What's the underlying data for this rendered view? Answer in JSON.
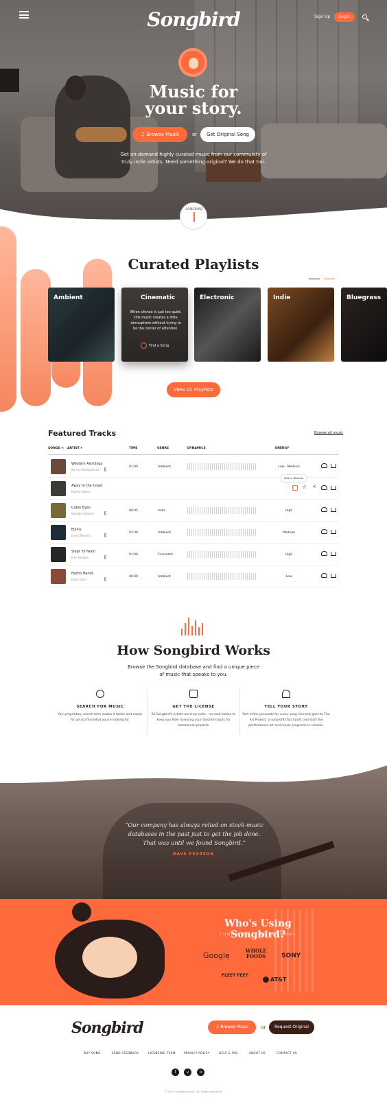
{
  "header": {
    "logo": "Songbird",
    "signup_label": "Sign Up",
    "login_label": "Login"
  },
  "hero": {
    "title_line1": "Music for",
    "title_line2": "your story.",
    "browse_label": "Browse Music",
    "or_label": "or",
    "original_label": "Get Original Song",
    "subtitle": "Get on-demand highly curated music from our community of truly indie artists. Need something original? We do that too.",
    "seal_text": "SONGBIRD"
  },
  "playlists": {
    "title": "Curated Playlists",
    "cards": [
      {
        "label": "Ambient"
      },
      {
        "label": "Cinematic",
        "desc": "When silence is just too quiet, this music creates a little atmosphere without trying to be the center of attention.",
        "action": "Find a Song"
      },
      {
        "label": "Electronic"
      },
      {
        "label": "Indie"
      },
      {
        "label": "Bluegrass"
      }
    ],
    "view_all": "View All Playlists"
  },
  "tracks": {
    "title": "Featured Tracks",
    "browse_all": "Browse all music",
    "headers": {
      "songs": "SONGS",
      "artist": "ARTIST",
      "time": "TIME",
      "genre": "GENRE",
      "dynamics": "DYNAMICS",
      "energy": "ENERGY"
    },
    "tooltip": "Add to Wishlist",
    "rows": [
      {
        "name": "Western Astrology",
        "artist": "Benny Hollingsworth",
        "time": "01:00",
        "genre": "Ambient",
        "energy": "Low - Medium",
        "color": "#6b4a3c"
      },
      {
        "name": "Away to the Coast",
        "artist": "Rachel Wanes",
        "time": "",
        "genre": "",
        "energy": "",
        "color": "#3e3a38"
      },
      {
        "name": "Cabin Eyes",
        "artist": "Georgia Clawson",
        "time": "00:45",
        "genre": "Indie",
        "energy": "High",
        "color": "#7a6a3a"
      },
      {
        "name": "Elkins",
        "artist": "Josiah Benson",
        "time": "02:30",
        "genre": "Ambient",
        "energy": "Medium",
        "color": "#1d2e3a"
      },
      {
        "name": "Slept 'til Noon",
        "artist": "John Hodges",
        "time": "01:00",
        "genre": "Cinematic",
        "energy": "High",
        "color": "#2a2624"
      },
      {
        "name": "Numb Hands",
        "artist": "Dean Ester",
        "time": "00:30",
        "genre": "Ambient",
        "energy": "Low",
        "color": "#8a4a3a"
      }
    ]
  },
  "how": {
    "title": "How Songbird Works",
    "subtitle": "Browse the Songbird database and find a unique piece of music that speaks to you.",
    "steps": [
      {
        "title": "SEARCH FOR MUSIC",
        "text": "Our proprietary search tech makes it faster and easier for you to find what you're looking for."
      },
      {
        "title": "GET THE LICENSE",
        "text": "All Songbird's artists are truly indie - no road blocks to keep you from licensing your favorite tracks for commercial projects."
      },
      {
        "title": "TELL YOUR STORY",
        "text": "Part of the proceeds for every song licensed goes to The Art Project; a nonprofit that funds cool stuff like performance art and music programs in schools."
      }
    ]
  },
  "testimonial": {
    "quote": "“Our company has always relied on stock-music databases in the past just to get the job done. That was until we found Songbird.”",
    "author": "DAVE PEARSON"
  },
  "who": {
    "title": "Who's Using Songbird?",
    "subtitle": "COMPANIES USING SONGBIRD",
    "brands": [
      "Google",
      "WHOLE FOODS",
      "SONY",
      "FLEET FEET",
      "AT&T"
    ]
  },
  "footer": {
    "logo": "Songbird",
    "browse_label": "Browse Music",
    "or_label": "or",
    "request_label": "Request Original",
    "nav": [
      "BUY SONG",
      "SEND FEEDBACK",
      "LICENSING TERM",
      "PRIVACY POLICY",
      "HELP & FAQ",
      "ABOUT US",
      "CONTACT US"
    ],
    "social": [
      "f",
      "v",
      "o"
    ],
    "copyright": "© 2018 Songbird Music. All Rights Reserved."
  },
  "colors": {
    "accent": "#ff6a3d",
    "dark": "#2a2220",
    "footer_button": "#3a1f17"
  }
}
